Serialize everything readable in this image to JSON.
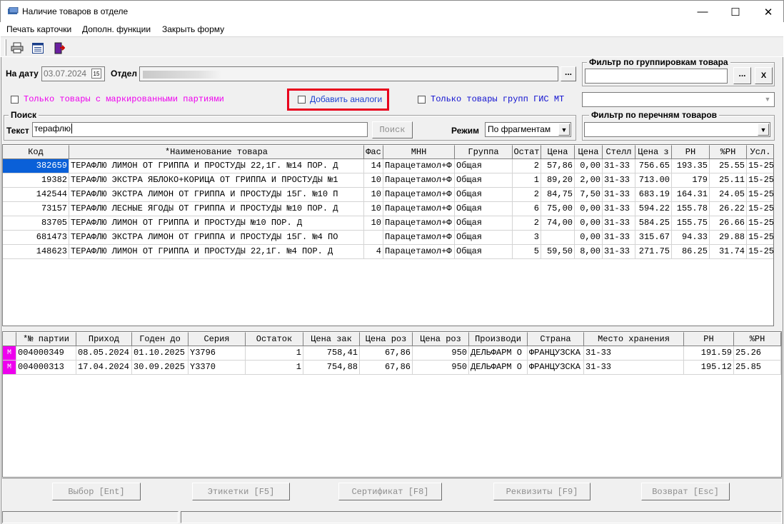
{
  "window": {
    "title": "Наличие товаров в отделе",
    "minimize": "—",
    "maximize": "☐",
    "close": "✕"
  },
  "menu": {
    "print_card": "Печать карточки",
    "extra_functions": "Дополн. функции",
    "close_form": "Закрыть форму"
  },
  "toolbar": {
    "icons": [
      "printer-icon",
      "list-icon",
      "exit-icon"
    ]
  },
  "filters": {
    "date_label": "На дату",
    "date_value": "03.07.2024",
    "calendar_button": "15",
    "department_label": "Отдел",
    "department_value": "",
    "ellipsis": "...",
    "group_filter_title": "Фильтр по группировкам товара",
    "group_filter_clear": "X",
    "marked_only_label": "Только товары с маркированными партиями",
    "add_analogs_label": "Добавить аналоги",
    "gis_mt_label": "Только товары групп ГИС МТ",
    "list_filter_title": "Фильтр по перечням товаров"
  },
  "search": {
    "title": "Поиск",
    "text_label": "Текст",
    "text_value": "терафлю",
    "search_button": "Поиск",
    "mode_label": "Режим",
    "mode_value": "По фрагментам"
  },
  "colors": {
    "accent": "#0a60d8",
    "marked_label": "#ee00ee",
    "gis_label": "#1010d0",
    "highlight_frame": "#e8001c",
    "row_marker": "#ee00ee"
  },
  "products": {
    "columns": [
      "Код",
      "*Наименование товара",
      "Фас",
      "МНН",
      "Группа",
      "Остат",
      "Цена",
      "Цена",
      "Стелл",
      "Цена з",
      "РН",
      "%РН",
      "Усл."
    ],
    "rows": [
      [
        "382659",
        "ТЕРАФЛЮ ЛИМОН ОТ ГРИППА И ПРОСТУДЫ 22,1Г. №14 ПОР. Д",
        "14",
        "Парацетамол+Ф",
        "Общая",
        "2",
        "57,86",
        "0,00",
        "31-33",
        "756.65",
        "193.35",
        "25.55",
        "15-25"
      ],
      [
        "19382",
        "ТЕРАФЛЮ ЭКСТРА ЯБЛОКО+КОРИЦА ОТ ГРИППА И ПРОСТУДЫ №1",
        "10",
        "Парацетамол+Ф",
        "Общая",
        "1",
        "89,20",
        "2,00",
        "31-33",
        "713.00",
        "179",
        "25.11",
        "15-25"
      ],
      [
        "142544",
        "ТЕРАФЛЮ ЭКСТРА ЛИМОН ОТ ГРИППА И ПРОСТУДЫ 15Г. №10 П",
        "10",
        "Парацетамол+Ф",
        "Общая",
        "2",
        "84,75",
        "7,50",
        "31-33",
        "683.19",
        "164.31",
        "24.05",
        "15-25"
      ],
      [
        "73157",
        "ТЕРАФЛЮ ЛЕСНЫЕ ЯГОДЫ ОТ ГРИППА И ПРОСТУДЫ №10 ПОР. Д",
        "10",
        "Парацетамол+Ф",
        "Общая",
        "6",
        "75,00",
        "0,00",
        "31-33",
        "594.22",
        "155.78",
        "26.22",
        "15-25"
      ],
      [
        "83705",
        "ТЕРАФЛЮ ЛИМОН ОТ ГРИППА И ПРОСТУДЫ №10 ПОР. Д",
        "10",
        "Парацетамол+Ф",
        "Общая",
        "2",
        "74,00",
        "0,00",
        "31-33",
        "584.25",
        "155.75",
        "26.66",
        "15-25"
      ],
      [
        "681473",
        "ТЕРАФЛЮ ЭКСТРА ЛИМОН ОТ ГРИППА И ПРОСТУДЫ 15Г. №4 ПО",
        "",
        "Парацетамол+Ф",
        "Общая",
        "3",
        "",
        "0,00",
        "31-33",
        "315.67",
        "94.33",
        "29.88",
        "15-25"
      ],
      [
        "148623",
        "ТЕРАФЛЮ ЛИМОН ОТ ГРИППА И ПРОСТУДЫ 22,1Г. №4 ПОР. Д",
        "4",
        "Парацетамол+Ф",
        "Общая",
        "5",
        "59,50",
        "8,00",
        "31-33",
        "271.75",
        "86.25",
        "31.74",
        "15-25"
      ]
    ]
  },
  "batches": {
    "columns": [
      "*№ партии",
      "Приход",
      "Годен до",
      "Серия",
      "Остаток",
      "Цена зак",
      "Цена роз",
      "Цена роз",
      "Производи",
      "Страна",
      "Место хранения",
      "РН",
      "%РН"
    ],
    "rows": [
      [
        "М",
        "004000349",
        "08.05.2024",
        "01.10.2025",
        "Y3796",
        "1",
        "758,41",
        "67,86",
        "950",
        "ДЕЛЬФАРМ О",
        "ФРАНЦУЗСКА",
        "31-33",
        "191.59",
        "25.26"
      ],
      [
        "М",
        "004000313",
        "17.04.2024",
        "30.09.2025",
        "Y3370",
        "1",
        "754,88",
        "67,86",
        "950",
        "ДЕЛЬФАРМ О",
        "ФРАНЦУЗСКА",
        "31-33",
        "195.12",
        "25.85"
      ]
    ]
  },
  "buttons": {
    "select": "Выбор [Ent]",
    "labels": "Этикетки [F5]",
    "certificate": "Сертификат [F8]",
    "details": "Реквизиты [F9]",
    "return": "Возврат [Esc]"
  }
}
